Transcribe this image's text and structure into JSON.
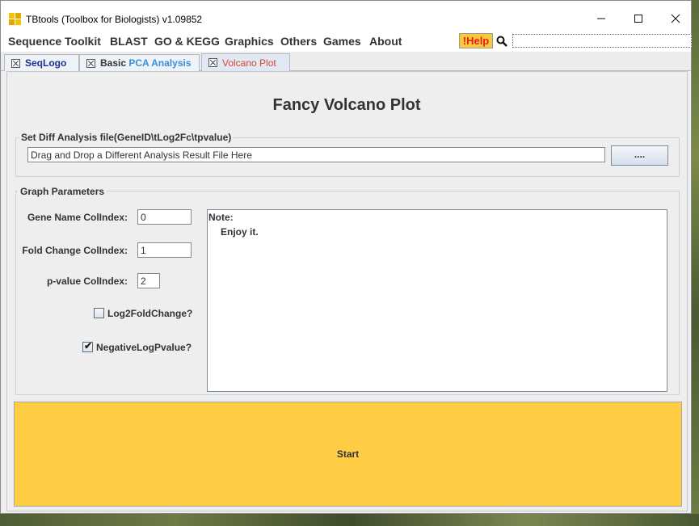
{
  "window": {
    "title": "TBtools (Toolbox for Biologists) v1.09852",
    "minimize_icon": "minimize-icon",
    "maximize_icon": "maximize-icon",
    "close_icon": "close-icon"
  },
  "menu": {
    "items": [
      "Sequence Toolkit",
      "BLAST",
      "GO & KEGG",
      "Graphics",
      "Others",
      "Games",
      "About"
    ],
    "help_label": "!Help",
    "search_value": ""
  },
  "tabs": [
    {
      "prefix": "",
      "label": "SeqLogo",
      "color": "#1a2f8f"
    },
    {
      "prefix": "Basic ",
      "label": "PCA Analysis",
      "color": "#3a8fd6"
    },
    {
      "prefix": "",
      "label": "Volcano Plot",
      "color": "#d7492f"
    }
  ],
  "active_tab": 2,
  "main": {
    "heading": "Fancy Volcano Plot",
    "file_group_title": "Set Diff Analysis file(GeneID\\tLog2Fc\\tpvalue)",
    "file_input_value": "Drag and Drop a Different Analysis Result File Here",
    "browse_label": "....",
    "params_group_title": "Graph Parameters",
    "gene_name_label": "Gene Name ColIndex:",
    "gene_name_value": "0",
    "fold_change_label": "Fold Change ColIndex:",
    "fold_change_value": "1",
    "pvalue_label": "p-value ColIndex:",
    "pvalue_value": "2",
    "log2_label": "Log2FoldChange?",
    "log2_checked": false,
    "neglog_label": "NegativeLogPvalue?",
    "neglog_checked": true,
    "note_title": "Note:",
    "note_text": "Enjoy it.",
    "start_label": "Start"
  },
  "colors": {
    "start_button": "#ffcc44",
    "help_button": "#f7ca3a",
    "help_text": "#e51c1c"
  }
}
